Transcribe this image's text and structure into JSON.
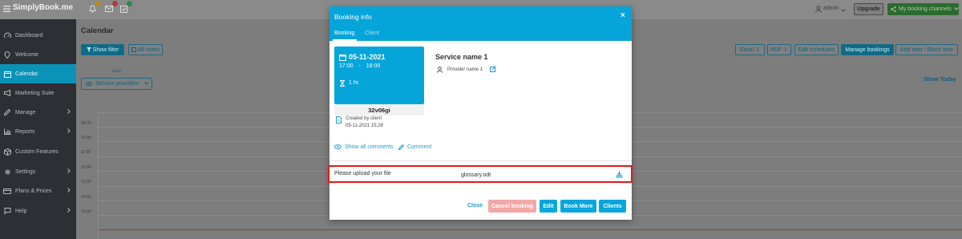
{
  "topbar": {
    "logo": "SimplyBook.me",
    "badges": [
      "",
      "",
      ""
    ],
    "user": "admin",
    "upgrade": "Upgrade",
    "channels": "My booking channels"
  },
  "sidebar": {
    "items": [
      {
        "label": "Dashboard",
        "icon": "dashboard-icon"
      },
      {
        "label": "Welcome",
        "icon": "location-pin-icon"
      },
      {
        "label": "Calendar",
        "icon": "calendar-icon",
        "active": true
      },
      {
        "label": "Marketing Suite",
        "icon": "megaphone-icon"
      },
      {
        "label": "Manage",
        "icon": "pencil-icon",
        "chevron": true
      },
      {
        "label": "Reports",
        "icon": "bar-chart-icon",
        "chevron": true
      },
      {
        "label": "Custom Features",
        "icon": "cube-icon"
      },
      {
        "label": "Settings",
        "icon": "gear-icon",
        "chevron": true
      },
      {
        "label": "Plans & Prices",
        "icon": "credit-card-icon",
        "chevron": true
      },
      {
        "label": "Help",
        "icon": "help-chat-icon",
        "chevron": true
      }
    ]
  },
  "main": {
    "title": "Calendar",
    "show_filter": "Show filter",
    "all_notes": "All notes",
    "view_label": "View",
    "view_select": "Service providers",
    "excel": "Excel",
    "pdf": "PDF",
    "edit_schedules": "Edit schedules",
    "manage_bookings": "Manage bookings",
    "add_note": "Add note / Block time",
    "show_today": "Show Today",
    "times": [
      "09:00",
      "10:00",
      "11:00",
      "12:00",
      "13:00",
      "14:00",
      "15:00"
    ]
  },
  "modal": {
    "title": "Booking info",
    "tabs": [
      "Booking",
      "Client"
    ],
    "date": "05-11-2021",
    "time_start": "17:00",
    "time_sep": "-",
    "time_end": "18:00",
    "duration": "1 hr.",
    "code": "32v06gi",
    "created_by": "Created by client",
    "created_at": "05-11-2021 15:28",
    "service_name": "Service name 1",
    "provider": "Provider name 1",
    "show_comments": "Show all comments",
    "comment": "Comment",
    "upload_label": "Please upload your file",
    "file_name": "glossary.odt",
    "close": "Close",
    "cancel_booking": "Cancel booking",
    "edit": "Edit",
    "book_more": "Book More",
    "clients": "Clients"
  },
  "colors": {
    "accent": "#05a5da",
    "sidebar": "#2e2e35",
    "highlight_border": "#e01b1b",
    "cancel_btn": "#f3a8a8"
  }
}
